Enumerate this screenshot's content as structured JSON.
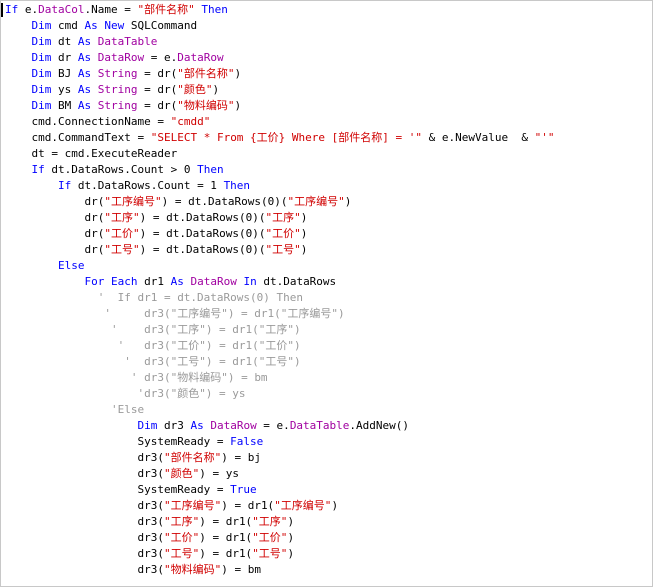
{
  "editor": {
    "colors": {
      "keyword": "#0000ff",
      "type": "#a000a0",
      "string": "#d00000",
      "comment": "#9a9a9a",
      "plain": "#000000"
    },
    "lines": [
      {
        "indent": 0,
        "tokens": [
          [
            "kw",
            "If "
          ],
          [
            "pl",
            "e."
          ],
          [
            "ty",
            "DataCol"
          ],
          [
            "pl",
            ".Name = "
          ],
          [
            "st",
            "\"部件名称\""
          ],
          [
            "kw",
            " Then"
          ]
        ]
      },
      {
        "indent": 4,
        "tokens": [
          [
            "kw",
            "Dim "
          ],
          [
            "pl",
            "cmd "
          ],
          [
            "kw",
            "As New "
          ],
          [
            "pl",
            "SQLCommand"
          ]
        ]
      },
      {
        "indent": 4,
        "tokens": [
          [
            "kw",
            "Dim "
          ],
          [
            "pl",
            "dt "
          ],
          [
            "kw",
            "As "
          ],
          [
            "ty",
            "DataTable"
          ]
        ]
      },
      {
        "indent": 4,
        "tokens": [
          [
            "kw",
            "Dim "
          ],
          [
            "pl",
            "dr "
          ],
          [
            "kw",
            "As "
          ],
          [
            "ty",
            "DataRow"
          ],
          [
            "pl",
            " = e."
          ],
          [
            "ty",
            "DataRow"
          ]
        ]
      },
      {
        "indent": 4,
        "tokens": [
          [
            "kw",
            "Dim "
          ],
          [
            "pl",
            "BJ "
          ],
          [
            "kw",
            "As "
          ],
          [
            "ty",
            "String"
          ],
          [
            "pl",
            " = dr("
          ],
          [
            "st",
            "\"部件名称\""
          ],
          [
            "pl",
            ")"
          ]
        ]
      },
      {
        "indent": 4,
        "tokens": [
          [
            "kw",
            "Dim "
          ],
          [
            "pl",
            "ys "
          ],
          [
            "kw",
            "As "
          ],
          [
            "ty",
            "String"
          ],
          [
            "pl",
            " = dr("
          ],
          [
            "st",
            "\"颜色\""
          ],
          [
            "pl",
            ")"
          ]
        ]
      },
      {
        "indent": 4,
        "tokens": [
          [
            "kw",
            "Dim "
          ],
          [
            "pl",
            "BM "
          ],
          [
            "kw",
            "As "
          ],
          [
            "ty",
            "String"
          ],
          [
            "pl",
            " = dr("
          ],
          [
            "st",
            "\"物料编码\""
          ],
          [
            "pl",
            ")"
          ]
        ]
      },
      {
        "indent": 4,
        "tokens": [
          [
            "pl",
            "cmd.ConnectionName = "
          ],
          [
            "st",
            "\"cmdd\""
          ]
        ]
      },
      {
        "indent": 4,
        "tokens": [
          [
            "pl",
            "cmd.CommandText = "
          ],
          [
            "st",
            "\"SELECT * From {工价} Where [部件名称] = '\""
          ],
          [
            "pl",
            " & e.NewValue  & "
          ],
          [
            "st",
            "\"'\""
          ]
        ]
      },
      {
        "indent": 4,
        "tokens": [
          [
            "pl",
            "dt = cmd.ExecuteReader"
          ]
        ]
      },
      {
        "indent": 4,
        "tokens": [
          [
            "kw",
            "If "
          ],
          [
            "pl",
            "dt.DataRows.Count > 0 "
          ],
          [
            "kw",
            "Then"
          ]
        ]
      },
      {
        "indent": 8,
        "tokens": [
          [
            "kw",
            "If "
          ],
          [
            "pl",
            "dt.DataRows.Count = 1 "
          ],
          [
            "kw",
            "Then"
          ]
        ]
      },
      {
        "indent": 12,
        "tokens": [
          [
            "pl",
            "dr("
          ],
          [
            "st",
            "\"工序编号\""
          ],
          [
            "pl",
            ") = dt.DataRows(0)("
          ],
          [
            "st",
            "\"工序编号\""
          ],
          [
            "pl",
            ")"
          ]
        ]
      },
      {
        "indent": 12,
        "tokens": [
          [
            "pl",
            "dr("
          ],
          [
            "st",
            "\"工序\""
          ],
          [
            "pl",
            ") = dt.DataRows(0)("
          ],
          [
            "st",
            "\"工序\""
          ],
          [
            "pl",
            ")"
          ]
        ]
      },
      {
        "indent": 12,
        "tokens": [
          [
            "pl",
            "dr("
          ],
          [
            "st",
            "\"工价\""
          ],
          [
            "pl",
            ") = dt.DataRows(0)("
          ],
          [
            "st",
            "\"工价\""
          ],
          [
            "pl",
            ")"
          ]
        ]
      },
      {
        "indent": 12,
        "tokens": [
          [
            "pl",
            "dr("
          ],
          [
            "st",
            "\"工号\""
          ],
          [
            "pl",
            ") = dt.DataRows(0)("
          ],
          [
            "st",
            "\"工号\""
          ],
          [
            "pl",
            ")"
          ]
        ]
      },
      {
        "indent": 8,
        "tokens": [
          [
            "kw",
            "Else"
          ]
        ]
      },
      {
        "indent": 12,
        "tokens": [
          [
            "kw",
            "For Each "
          ],
          [
            "pl",
            "dr1 "
          ],
          [
            "kw",
            "As "
          ],
          [
            "ty",
            "DataRow"
          ],
          [
            "kw",
            " In "
          ],
          [
            "pl",
            "dt.DataRows"
          ]
        ]
      },
      {
        "indent": 14,
        "tokens": [
          [
            "cm",
            "'  If dr1 = dt.DataRows(0) Then"
          ]
        ]
      },
      {
        "indent": 15,
        "tokens": [
          [
            "cm",
            "'     dr3(\"工序编号\") = dr1(\"工序编号\")"
          ]
        ]
      },
      {
        "indent": 16,
        "tokens": [
          [
            "cm",
            "'    dr3(\"工序\") = dr1(\"工序\")"
          ]
        ]
      },
      {
        "indent": 17,
        "tokens": [
          [
            "cm",
            "'   dr3(\"工价\") = dr1(\"工价\")"
          ]
        ]
      },
      {
        "indent": 18,
        "tokens": [
          [
            "cm",
            "'  dr3(\"工号\") = dr1(\"工号\")"
          ]
        ]
      },
      {
        "indent": 19,
        "tokens": [
          [
            "cm",
            "' dr3(\"物料编码\") = bm"
          ]
        ]
      },
      {
        "indent": 20,
        "tokens": [
          [
            "cm",
            "'dr3(\"颜色\") = ys"
          ]
        ]
      },
      {
        "indent": 16,
        "tokens": [
          [
            "cm",
            "'Else"
          ]
        ]
      },
      {
        "indent": 20,
        "tokens": [
          [
            "kw",
            "Dim "
          ],
          [
            "pl",
            "dr3 "
          ],
          [
            "kw",
            "As "
          ],
          [
            "ty",
            "DataRow"
          ],
          [
            "pl",
            " = e."
          ],
          [
            "ty",
            "DataTable"
          ],
          [
            "pl",
            ".AddNew()"
          ]
        ]
      },
      {
        "indent": 20,
        "tokens": [
          [
            "pl",
            "SystemReady = "
          ],
          [
            "kw",
            "False"
          ]
        ]
      },
      {
        "indent": 20,
        "tokens": [
          [
            "pl",
            "dr3("
          ],
          [
            "st",
            "\"部件名称\""
          ],
          [
            "pl",
            ") = bj"
          ]
        ]
      },
      {
        "indent": 20,
        "tokens": [
          [
            "pl",
            "dr3("
          ],
          [
            "st",
            "\"颜色\""
          ],
          [
            "pl",
            ") = ys"
          ]
        ]
      },
      {
        "indent": 20,
        "tokens": [
          [
            "pl",
            "SystemReady = "
          ],
          [
            "kw",
            "True"
          ]
        ]
      },
      {
        "indent": 20,
        "tokens": [
          [
            "pl",
            "dr3("
          ],
          [
            "st",
            "\"工序编号\""
          ],
          [
            "pl",
            ") = dr1("
          ],
          [
            "st",
            "\"工序编号\""
          ],
          [
            "pl",
            ")"
          ]
        ]
      },
      {
        "indent": 20,
        "tokens": [
          [
            "pl",
            "dr3("
          ],
          [
            "st",
            "\"工序\""
          ],
          [
            "pl",
            ") = dr1("
          ],
          [
            "st",
            "\"工序\""
          ],
          [
            "pl",
            ")"
          ]
        ]
      },
      {
        "indent": 20,
        "tokens": [
          [
            "pl",
            "dr3("
          ],
          [
            "st",
            "\"工价\""
          ],
          [
            "pl",
            ") = dr1("
          ],
          [
            "st",
            "\"工价\""
          ],
          [
            "pl",
            ")"
          ]
        ]
      },
      {
        "indent": 20,
        "tokens": [
          [
            "pl",
            "dr3("
          ],
          [
            "st",
            "\"工号\""
          ],
          [
            "pl",
            ") = dr1("
          ],
          [
            "st",
            "\"工号\""
          ],
          [
            "pl",
            ")"
          ]
        ]
      },
      {
        "indent": 20,
        "tokens": [
          [
            "pl",
            "dr3("
          ],
          [
            "st",
            "\"物料编码\""
          ],
          [
            "pl",
            ") = bm"
          ]
        ]
      }
    ]
  }
}
